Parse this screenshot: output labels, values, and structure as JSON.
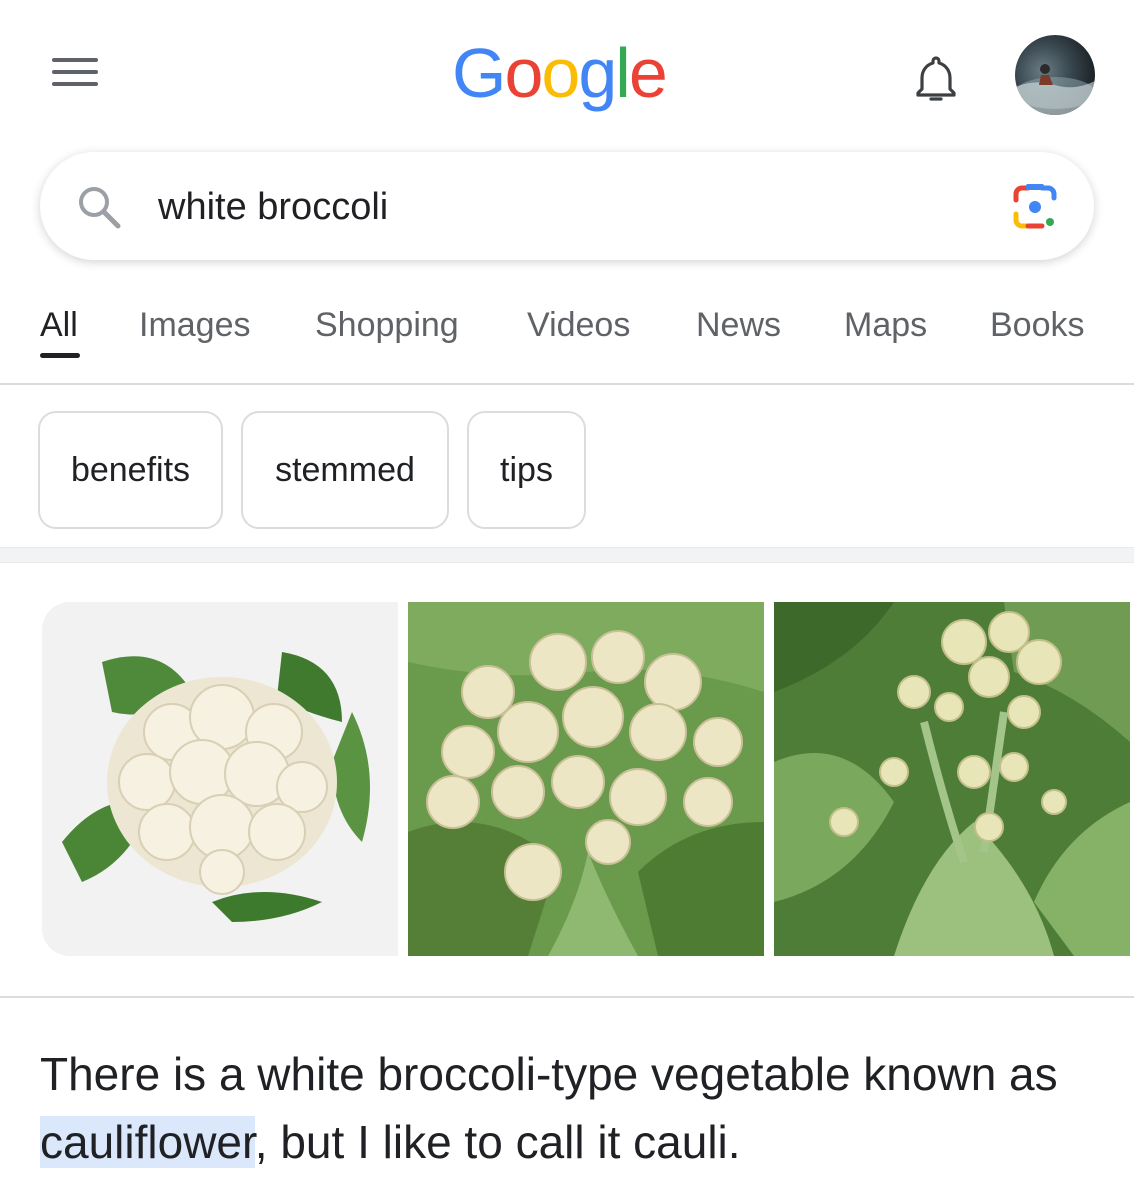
{
  "header": {
    "logo": {
      "G": "G",
      "o1": "o",
      "o2": "o",
      "g": "g",
      "l": "l",
      "e": "e"
    },
    "logo_colors": {
      "blue": "#4285f4",
      "red": "#ea4335",
      "yellow": "#fbbc05",
      "green": "#34a853"
    },
    "icons": [
      "menu-icon",
      "bell-icon",
      "avatar"
    ]
  },
  "search": {
    "query": "white broccoli",
    "icons": [
      "search-icon",
      "google-lens-icon"
    ]
  },
  "tabs": [
    {
      "label": "All",
      "active": true
    },
    {
      "label": "Images"
    },
    {
      "label": "Shopping"
    },
    {
      "label": "Videos"
    },
    {
      "label": "News"
    },
    {
      "label": "Maps"
    },
    {
      "label": "Books"
    }
  ],
  "chips": [
    {
      "label": "benefits"
    },
    {
      "label": "stemmed"
    },
    {
      "label": "tips"
    }
  ],
  "images": [
    {
      "subject": "cauliflower-head-on-white"
    },
    {
      "subject": "white-broccoli-plant"
    },
    {
      "subject": "white-broccoli-plant-field"
    }
  ],
  "answer": {
    "before": "There is a white broccoli-type vegetable known as ",
    "highlight": "cauliflower",
    "after": ", but I like to call it cauli."
  }
}
